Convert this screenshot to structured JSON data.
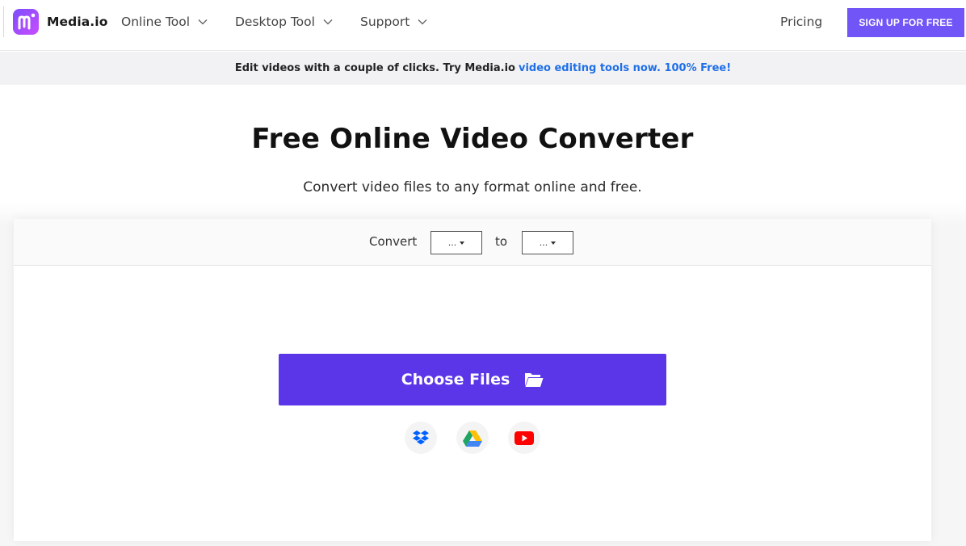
{
  "nav": {
    "brand": "Media.io",
    "items": [
      {
        "label": "Online Tool",
        "icon": "chevron-down-icon"
      },
      {
        "label": "Desktop Tool",
        "icon": "chevron-down-icon"
      },
      {
        "label": "Support",
        "icon": "chevron-down-icon"
      }
    ],
    "pricing": "Pricing",
    "signup": "SIGN UP FOR FREE",
    "accent": "#7255f6"
  },
  "promo": {
    "text": "Edit videos with a couple of clicks. Try Media.io",
    "link": "video editing tools now. 100% Free!",
    "link_color": "#1e6fe8"
  },
  "hero": {
    "title": "Free Online Video Converter",
    "subtitle": "Convert video files to any format online and free."
  },
  "converter": {
    "convert_label": "Convert",
    "from_value": "...",
    "to_label": "to",
    "to_value": "...",
    "choose_files": "Choose Files",
    "choose_color": "#5b36e8",
    "sources": [
      {
        "name": "Dropbox",
        "icon": "dropbox-icon"
      },
      {
        "name": "Google Drive",
        "icon": "google-drive-icon"
      },
      {
        "name": "YouTube",
        "icon": "youtube-icon"
      }
    ]
  }
}
